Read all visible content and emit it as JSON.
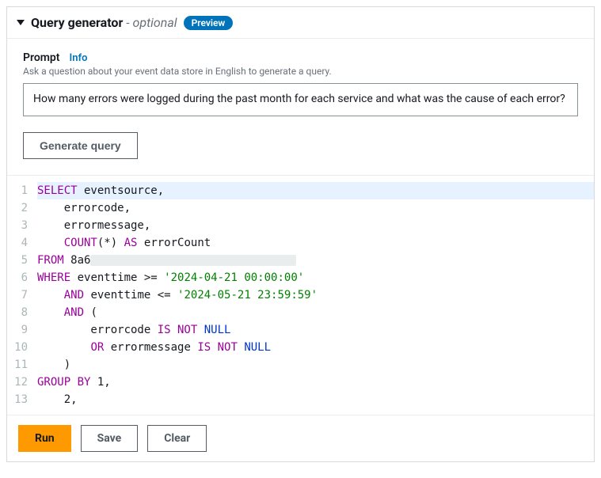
{
  "header": {
    "title": "Query generator",
    "optional_suffix": "- optional",
    "badge": "Preview"
  },
  "prompt": {
    "label": "Prompt",
    "info_link": "Info",
    "description": "Ask a question about your event data store in English to generate a query.",
    "value": "How many errors were logged during the past month for each service and what was the cause of each error?"
  },
  "generate_button": "Generate query",
  "code": {
    "lines": [
      {
        "n": 1,
        "tokens": [
          {
            "t": "SELECT",
            "c": "kw"
          },
          {
            "t": " eventsource,",
            "c": "ident"
          }
        ]
      },
      {
        "n": 2,
        "tokens": [
          {
            "t": "    errorcode,",
            "c": "ident"
          }
        ]
      },
      {
        "n": 3,
        "tokens": [
          {
            "t": "    errormessage,",
            "c": "ident"
          }
        ]
      },
      {
        "n": 4,
        "tokens": [
          {
            "t": "    ",
            "c": "ident"
          },
          {
            "t": "COUNT",
            "c": "fn"
          },
          {
            "t": "(*)",
            "c": "punct"
          },
          {
            "t": " ",
            "c": "ident"
          },
          {
            "t": "AS",
            "c": "kw"
          },
          {
            "t": " errorCount",
            "c": "ident"
          }
        ]
      },
      {
        "n": 5,
        "tokens": [
          {
            "t": "FROM",
            "c": "kw"
          },
          {
            "t": " 8a6",
            "c": "ident"
          },
          {
            "t": "__REDACTED__",
            "c": "redacted"
          }
        ]
      },
      {
        "n": 6,
        "tokens": [
          {
            "t": "WHERE",
            "c": "kw"
          },
          {
            "t": " eventtime >= ",
            "c": "ident"
          },
          {
            "t": "'2024-04-21 00:00:00'",
            "c": "str"
          }
        ]
      },
      {
        "n": 7,
        "tokens": [
          {
            "t": "    ",
            "c": "ident"
          },
          {
            "t": "AND",
            "c": "kw"
          },
          {
            "t": " eventtime <= ",
            "c": "ident"
          },
          {
            "t": "'2024-05-21 23:59:59'",
            "c": "str"
          }
        ]
      },
      {
        "n": 8,
        "tokens": [
          {
            "t": "    ",
            "c": "ident"
          },
          {
            "t": "AND",
            "c": "kw"
          },
          {
            "t": " (",
            "c": "ident"
          }
        ]
      },
      {
        "n": 9,
        "tokens": [
          {
            "t": "        errorcode ",
            "c": "ident"
          },
          {
            "t": "IS NOT",
            "c": "kw"
          },
          {
            "t": " ",
            "c": "ident"
          },
          {
            "t": "NULL",
            "c": "nullkw"
          }
        ]
      },
      {
        "n": 10,
        "tokens": [
          {
            "t": "        ",
            "c": "ident"
          },
          {
            "t": "OR",
            "c": "kw"
          },
          {
            "t": " errormessage ",
            "c": "ident"
          },
          {
            "t": "IS NOT",
            "c": "kw"
          },
          {
            "t": " ",
            "c": "ident"
          },
          {
            "t": "NULL",
            "c": "nullkw"
          }
        ]
      },
      {
        "n": 11,
        "tokens": [
          {
            "t": "    )",
            "c": "ident"
          }
        ]
      },
      {
        "n": 12,
        "tokens": [
          {
            "t": "GROUP BY",
            "c": "kw"
          },
          {
            "t": " 1,",
            "c": "ident"
          }
        ]
      },
      {
        "n": 13,
        "tokens": [
          {
            "t": "    2,",
            "c": "ident"
          }
        ]
      }
    ]
  },
  "actions": {
    "run": "Run",
    "save": "Save",
    "clear": "Clear"
  }
}
